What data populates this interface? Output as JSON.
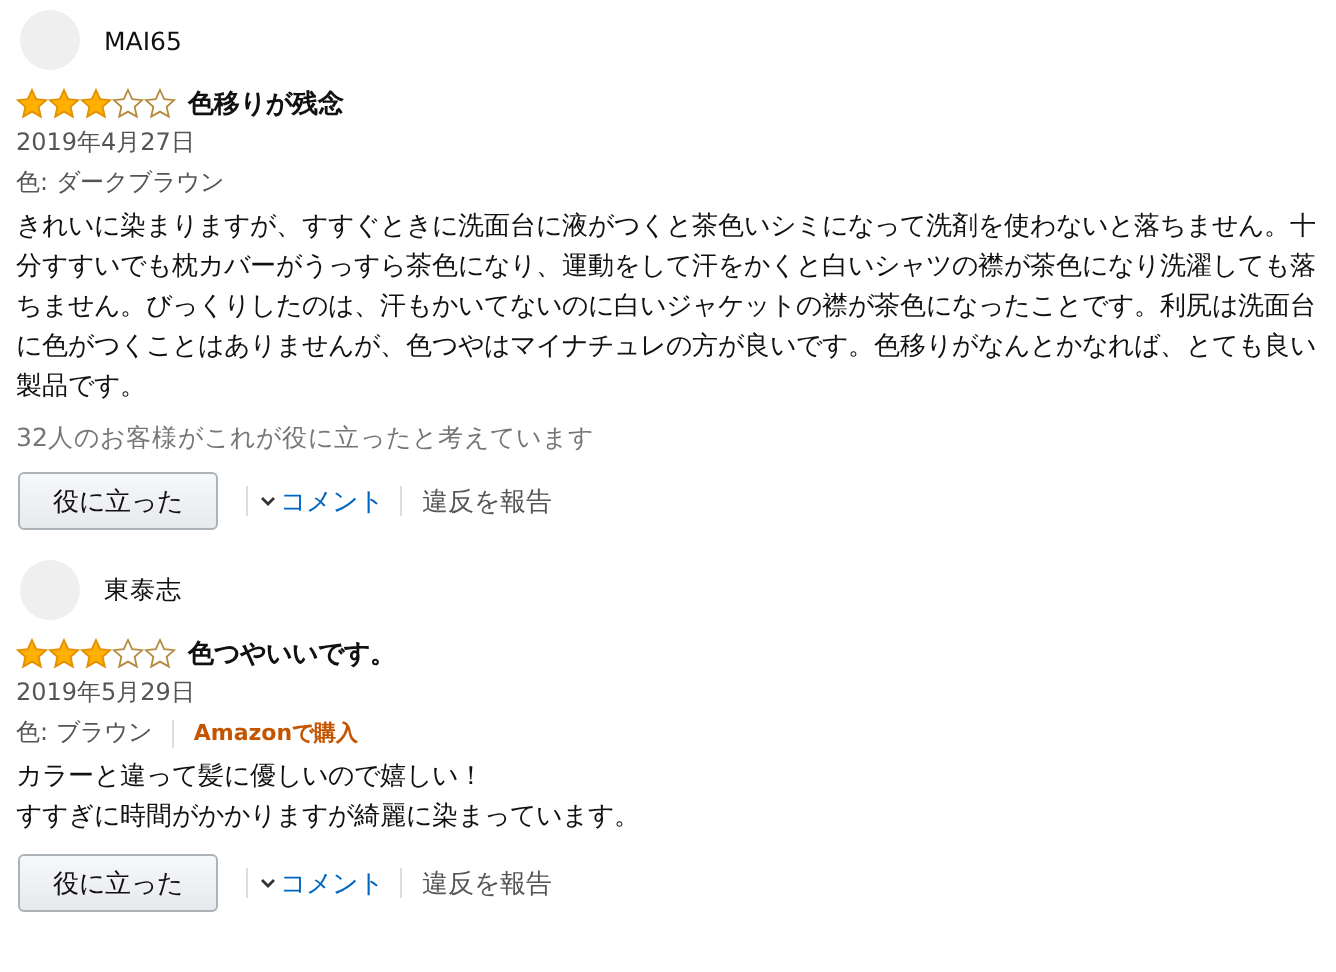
{
  "reviews": [
    {
      "name": "MAI65",
      "stars": 3,
      "title": "色移りが残念",
      "date": "2019年4月27日",
      "variant": "色: ダークブラウン",
      "body": "きれいに染まりますが、すすぐときに洗面台に液がつくと茶色いシミになって洗剤を使わないと落ちません。十分すすいでも枕カバーがうっすら茶色になり、運動をして汗をかくと白いシャツの襟が茶色になり洗濯しても落ちません。びっくりしたのは、汗もかいてないのに白いジャケットの襟が茶色になったことです。利尻は洗面台に色がつくことはありませんが、色つやはマイナチュレの方が良いです。色移りがなんとかなれば、とても良い製品です。",
      "helpful_text": "32人のお客様がこれが役に立ったと考えています",
      "helpful_button": "役に立った",
      "comment": "コメント",
      "report": "違反を報告"
    },
    {
      "name": "東泰志",
      "stars": 3,
      "title": "色つやいいです。",
      "date": "2019年5月29日",
      "variant": "色: ブラウン",
      "badge": "Amazonで購入",
      "body_lines": [
        "カラーと違って髪に優しいので嬉しい！",
        "すすぎに時間がかかりますが綺麗に染まっています。"
      ],
      "helpful_button": "役に立った",
      "comment": "コメント",
      "report": "違反を報告"
    }
  ]
}
